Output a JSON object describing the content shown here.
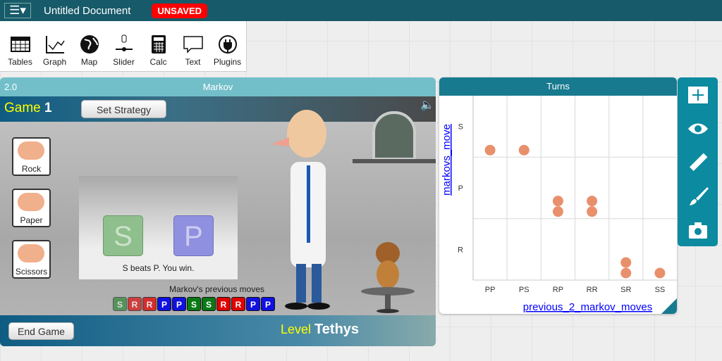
{
  "app": {
    "menu_icon": "hamburger-menu-icon",
    "title": "Untitled Document",
    "status": "UNSAVED"
  },
  "toolbar": [
    {
      "label": "Tables",
      "icon": "table-icon"
    },
    {
      "label": "Graph",
      "icon": "graph-icon"
    },
    {
      "label": "Map",
      "icon": "globe-icon"
    },
    {
      "label": "Slider",
      "icon": "slider-icon"
    },
    {
      "label": "Calc",
      "icon": "calculator-icon"
    },
    {
      "label": "Text",
      "icon": "text-bubble-icon"
    },
    {
      "label": "Plugins",
      "icon": "plug-icon"
    }
  ],
  "markov": {
    "version": "2.0",
    "title": "Markov",
    "game_label": "Game",
    "game_number": "1",
    "set_strategy": "Set Strategy",
    "hands": [
      "Rock",
      "Paper",
      "Scissors"
    ],
    "player_card": "S",
    "markov_card": "P",
    "result": "S beats P. You win.",
    "previous_label": "Markov's previous moves",
    "previous_moves": [
      "S",
      "R",
      "R",
      "P",
      "P",
      "S",
      "S",
      "R",
      "R",
      "P",
      "P"
    ],
    "end_game": "End Game",
    "level_label": "Level",
    "level_name": "Tethys",
    "colors": {
      "S": "#0a7a14",
      "R": "#e00000",
      "P": "#1010e0"
    }
  },
  "graph": {
    "title": "Turns"
  },
  "chart_data": {
    "type": "scatter",
    "xlabel": "previous_2_markov_moves",
    "ylabel": "markovs_move",
    "x_categories": [
      "PP",
      "PS",
      "RP",
      "RR",
      "SR",
      "SS"
    ],
    "y_categories": [
      "R",
      "P",
      "S"
    ],
    "points": [
      [
        "PP",
        "S"
      ],
      [
        "PS",
        "S"
      ],
      [
        "RP",
        "P"
      ],
      [
        "RP",
        "P"
      ],
      [
        "RR",
        "P"
      ],
      [
        "RR",
        "P"
      ],
      [
        "SR",
        "R"
      ],
      [
        "SR",
        "R"
      ],
      [
        "SS",
        "R"
      ]
    ],
    "point_color": "#e8906c",
    "grid": true
  },
  "palette": [
    "rescale-icon",
    "eye-icon",
    "ruler-icon",
    "paintbrush-icon",
    "camera-icon"
  ]
}
